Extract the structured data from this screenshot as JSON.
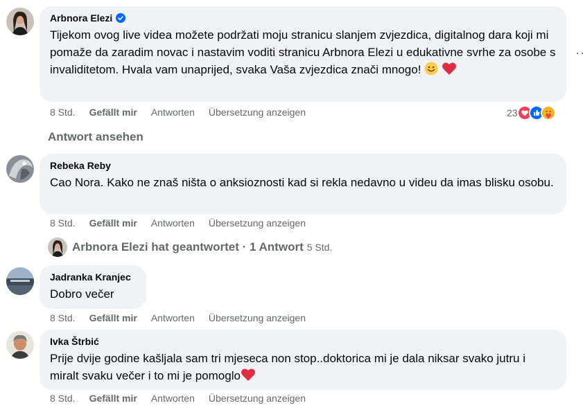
{
  "comments": [
    {
      "author": "Arbnora Elezi",
      "verified": true,
      "text": "Tijekom ovog live videa možete podržati moju stranicu slanjem zvjezdica, digitalnog dara koji mi pomaže da zaradim novac i nastavim voditi stranicu Arbnora Elezi u edukativne svrhe za osobe s invaliditetom. Hvala vam unaprijed, svaka Vaša zvjezdica znači mnogo!",
      "time": "8 Std.",
      "like_label": "Gefällt mir",
      "reply_label": "Antworten",
      "translate_label": "Übersetzung anzeigen",
      "reaction_count": "23",
      "view_replies": "Antwort ansehen"
    },
    {
      "author": "Rebeka Reby",
      "text": "Cao Nora. Kako ne znaš ništa o anksioznosti kad si rekla nedavno u videu da imas blisku osobu.",
      "time": "8 Std.",
      "like_label": "Gefällt mir",
      "reply_label": "Antworten",
      "translate_label": "Übersetzung anzeigen",
      "reply_summary": "Arbnora Elezi hat geantwortet · 1 Antwort",
      "reply_summary_time": "5 Std."
    },
    {
      "author": "Jadranka Kranjec",
      "text": "Dobro večer",
      "time": "8 Std.",
      "like_label": "Gefällt mir",
      "reply_label": "Antworten",
      "translate_label": "Übersetzung anzeigen"
    },
    {
      "author": "Ivka Štrbić",
      "text": "Prije dvije godine kašljala sam tri mjeseca non stop..doktorica mi je dala niksar svako jutru i miralt svaku večer i to mi je pomoglo",
      "time": "8 Std.",
      "like_label": "Gefällt mir",
      "reply_label": "Antworten",
      "translate_label": "Übersetzung anzeigen"
    }
  ],
  "more_options": "···",
  "icons": {
    "verified": "verified-badge-icon",
    "reactions": [
      "love-reaction-icon",
      "like-reaction-icon",
      "care-reaction-icon"
    ]
  },
  "colors": {
    "bubble": "#f0f2f5",
    "secondary_text": "#65676b",
    "verified": "#0866ff",
    "love": "#f33e58",
    "like": "#0866ff"
  }
}
